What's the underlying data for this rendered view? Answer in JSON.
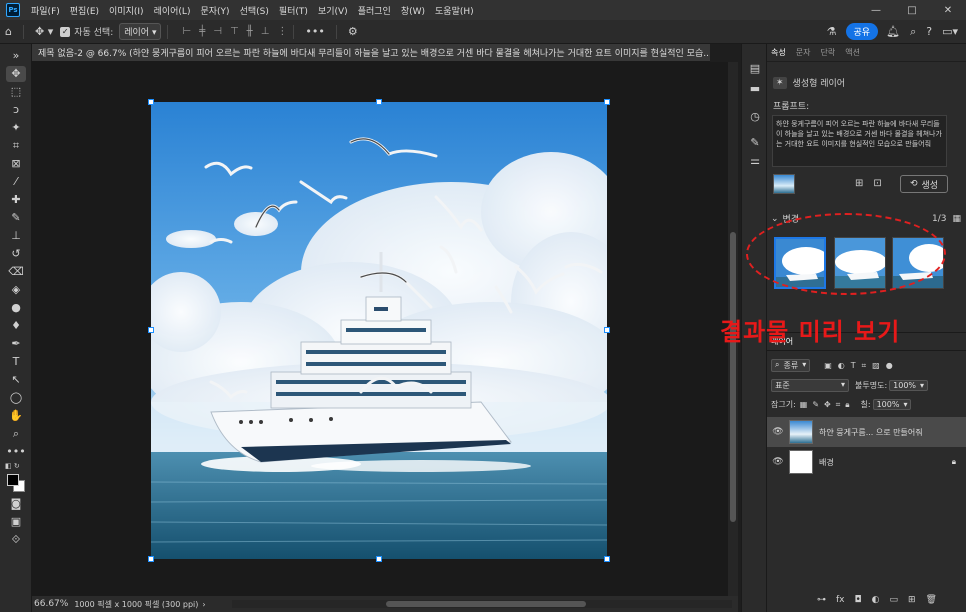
{
  "app": {
    "logo": "Ps"
  },
  "menu": [
    "파일(F)",
    "편집(E)",
    "이미지(I)",
    "레이어(L)",
    "문자(Y)",
    "선택(S)",
    "필터(T)",
    "보기(V)",
    "플러그인",
    "창(W)",
    "도움말(H)"
  ],
  "window_controls": [
    "—",
    "□",
    "✕"
  ],
  "optionsbar": {
    "auto_select_label": "자동 선택:",
    "auto_select_value": "레이어",
    "share_label": "공유"
  },
  "document": {
    "tab_title": "제목 없음-2 @ 66.7% (하얀 뭉게구름이 피어 오르는 파란 하늘에 바다새 무리들이 하늘을 날고 있는 배경으로 거센 바다 물결을 헤쳐나가는 거대한 요트 이미지를 현실적인 모습...",
    "close": "×",
    "zoom": "66.67%",
    "info": "1000 픽셀 x 1000 픽셀 (300 ppi)"
  },
  "panel_tabs": [
    "속성",
    "문자",
    "단락",
    "액션"
  ],
  "properties": {
    "layer_type": "생성형 레이어",
    "prompt_label": "프롬프트:",
    "prompt_text": "하얀 뭉게구름이 피어 오르는 파란 하늘에 바다새 무리들이 하늘을 날고 있는 배경으로 거센 바다 물결을 헤쳐나가는 거대한 요트 이미지를 현실적인 모습으로 만들어줘",
    "generate_label": "생성",
    "variations_label": "변경",
    "variations_count": "1/3"
  },
  "annotation": {
    "text": "결과물 미리 보기",
    "color": "#e81919"
  },
  "layers_panel": {
    "filter_label": "종류",
    "blend_mode": "표준",
    "opacity_label": "불투명도:",
    "opacity_value": "100%",
    "lock_label": "잠그기:",
    "fill_label": "칠:",
    "fill_value": "100%",
    "layers": [
      {
        "name": "하얀 뭉게구름... 으로 만들어줘",
        "selected": true
      },
      {
        "name": "배경",
        "selected": false
      }
    ]
  },
  "colors": {
    "accent": "#1473e6",
    "selection": "#1e78e6"
  }
}
